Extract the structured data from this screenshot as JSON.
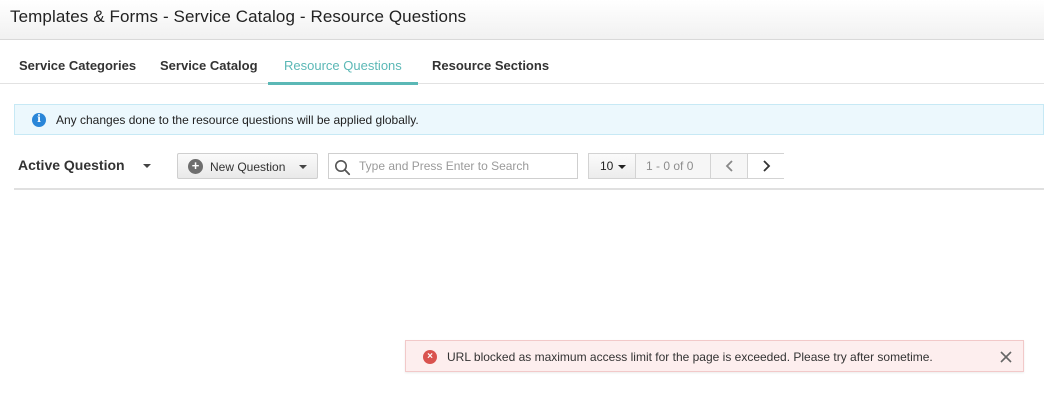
{
  "header": {
    "title": "Templates & Forms - Service Catalog - Resource Questions"
  },
  "tabs": [
    {
      "label": "Service Categories",
      "active": false
    },
    {
      "label": "Service Catalog",
      "active": false
    },
    {
      "label": "Resource Questions",
      "active": true
    },
    {
      "label": "Resource Sections",
      "active": false
    }
  ],
  "info_banner": {
    "icon": "info-icon",
    "text": "Any changes done to the resource questions will be applied globally."
  },
  "toolbar": {
    "filter_label": "Active Question",
    "new_button_label": "New Question",
    "search_placeholder": "Type and Press Enter to Search",
    "search_value": ""
  },
  "pagination": {
    "page_size": "10",
    "range": "1 - 0 of 0"
  },
  "toast": {
    "type": "error",
    "message": "URL blocked as maximum access limit for the page is exceeded. Please try after sometime."
  },
  "colors": {
    "accent": "#5bb8b6",
    "info_icon": "#2a86d8",
    "error_icon": "#d9534f"
  }
}
